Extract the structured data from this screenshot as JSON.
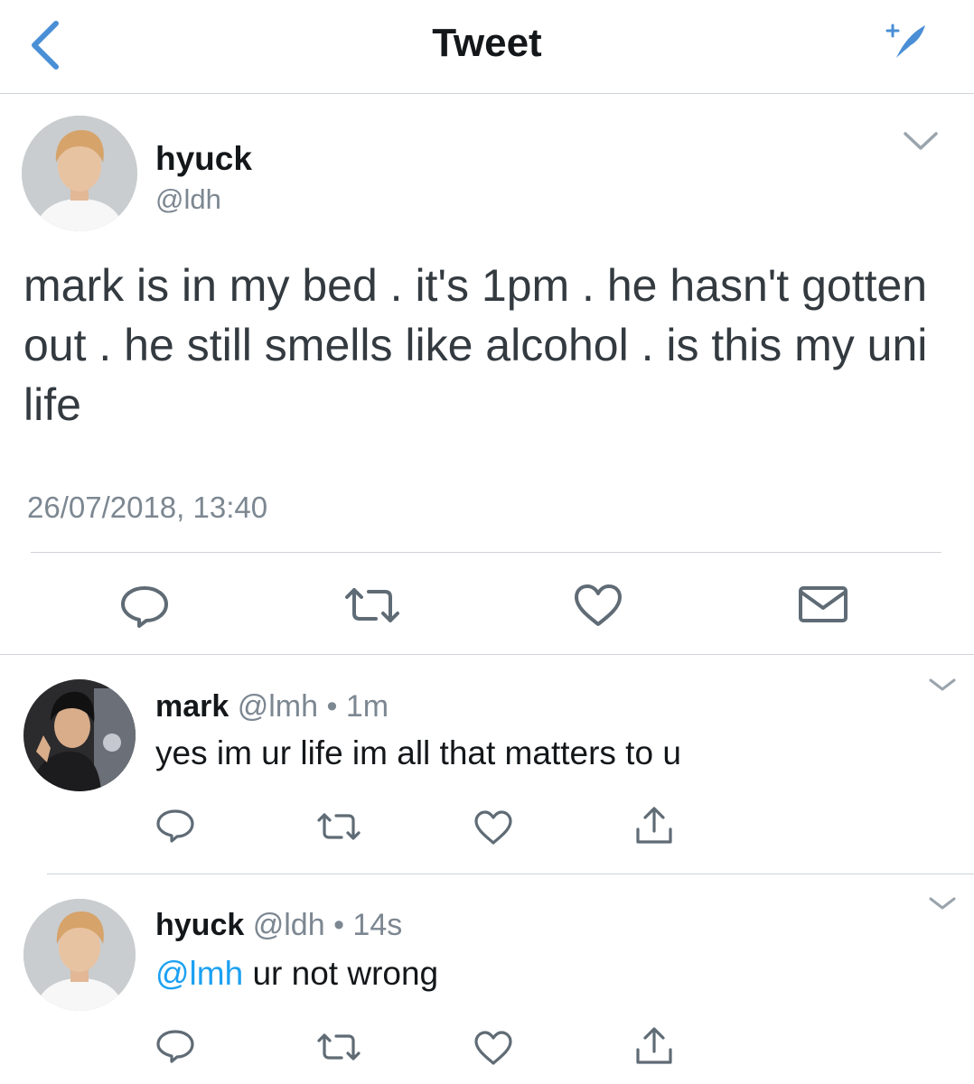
{
  "header": {
    "title": "Tweet"
  },
  "main_tweet": {
    "name": "hyuck",
    "handle": "@ldh",
    "text": "mark is in my bed . it's 1pm . he hasn't gotten out . he still smells like alcohol . is this my uni life",
    "timestamp": "26/07/2018, 13:40",
    "actions": [
      "reply-icon",
      "retweet-icon",
      "like-icon",
      "direct-message-icon"
    ]
  },
  "replies": [
    {
      "name": "mark",
      "handle": "@lmh",
      "separator": "•",
      "time": "1m",
      "text": "yes im ur life im all that matters to u",
      "actions": [
        "reply-icon",
        "retweet-icon",
        "like-icon",
        "share-icon"
      ]
    },
    {
      "name": "hyuck",
      "handle": "@ldh",
      "separator": "•",
      "time": "14s",
      "mention": "@lmh",
      "text": " ur not wrong",
      "actions": [
        "reply-icon",
        "retweet-icon",
        "like-icon",
        "share-icon"
      ]
    }
  ],
  "colors": {
    "accent": "#1da1f2",
    "back_arrow": "#4a8fd6",
    "muted_text": "#7c8791",
    "icon": "#5f6b75",
    "divider": "#cfd4d8"
  }
}
